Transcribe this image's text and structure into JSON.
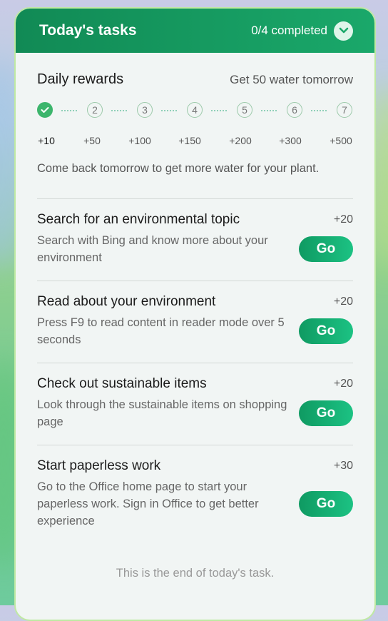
{
  "header": {
    "title": "Today's tasks",
    "progress": "0/4 completed"
  },
  "rewards": {
    "title": "Daily rewards",
    "hint": "Get 50 water tomorrow",
    "steps": [
      "2",
      "3",
      "4",
      "5",
      "6",
      "7"
    ],
    "completed_steps": 1,
    "values": [
      "+10",
      "+50",
      "+100",
      "+150",
      "+200",
      "+300",
      "+500"
    ],
    "note": "Come back tomorrow to get more water for your plant."
  },
  "tasks": [
    {
      "title": "Search for an environmental topic",
      "points": "+20",
      "desc": "Search with Bing and know more about your environment",
      "button": "Go"
    },
    {
      "title": "Read about your environment",
      "points": "+20",
      "desc": "Press F9 to read content in reader mode over 5 seconds",
      "button": "Go"
    },
    {
      "title": "Check out sustainable items",
      "points": "+20",
      "desc": "Look through the sustainable items on shopping page",
      "button": "Go"
    },
    {
      "title": "Start paperless work",
      "points": "+30",
      "desc": "Go to the Office home page to start your paperless work. Sign in Office to get better experience",
      "button": "Go"
    }
  ],
  "footer": {
    "end_text": "This is the end of today's task."
  },
  "colors": {
    "accent": "#1aa86a",
    "panel_border": "#bfe9a3",
    "step_done": "#3cb56c"
  },
  "icons": {
    "collapse": "chevron-down-icon",
    "step_done": "checkmark-icon"
  }
}
